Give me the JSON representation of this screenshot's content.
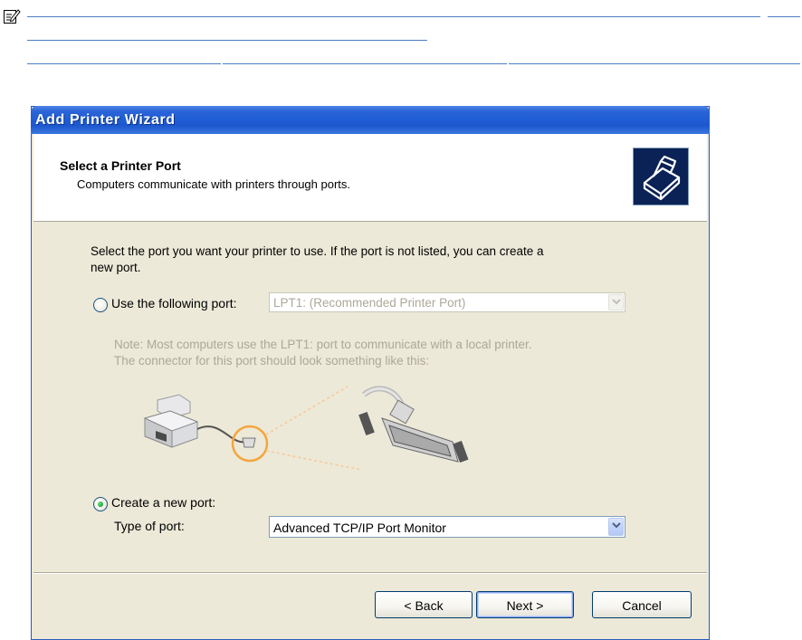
{
  "note_icon": "note-pencil-icon",
  "dialog": {
    "title": "Add Printer Wizard",
    "header": {
      "title": "Select a Printer Port",
      "subtitle": "Computers communicate with printers through ports.",
      "icon": "printer-icon"
    },
    "instructions_line1": "Select the port you want your printer to use.  If the port is not listed, you can create a",
    "instructions_line2": "new port.",
    "use_port": {
      "label": "Use the following port:",
      "selected": false,
      "value": "LPT1: (Recommended Printer Port)"
    },
    "note_line1": "Note: Most computers use the LPT1: port to communicate with a local printer.",
    "note_line2": "The connector for this port should look something like this:",
    "create_port": {
      "label": "Create a new port:",
      "selected": true,
      "type_label": "Type of port:",
      "type_value": "Advanced TCP/IP Port Monitor"
    },
    "buttons": {
      "back": "< Back",
      "next": "Next >",
      "cancel": "Cancel"
    }
  },
  "colors": {
    "title_bar": "#245edb",
    "dialog_bg": "#ece9d8",
    "link_rule": "#4a7fc4"
  }
}
